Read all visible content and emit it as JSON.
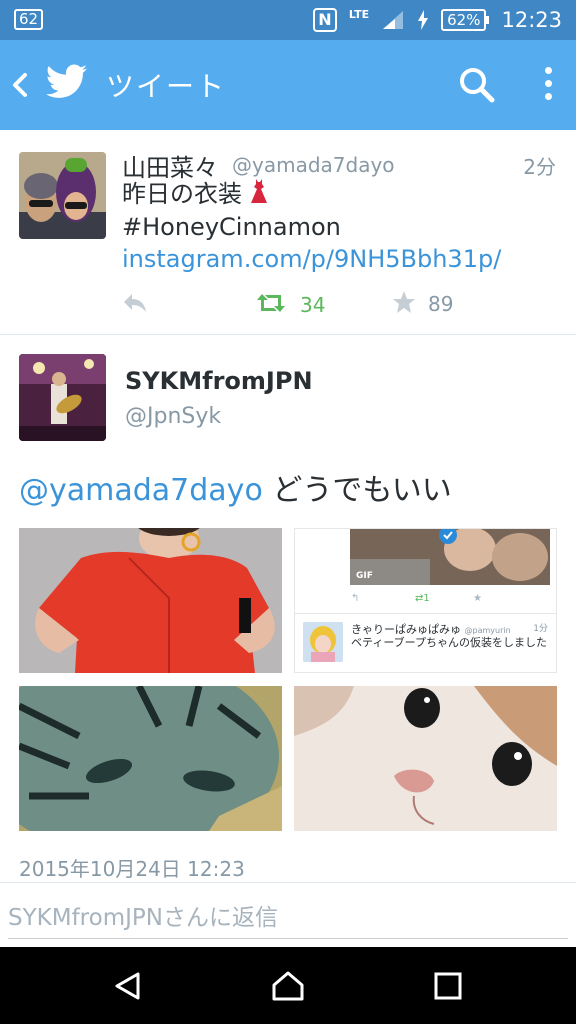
{
  "status_bar": {
    "notification_count": "62",
    "network": "LTE",
    "battery": "62%",
    "time": "12:23",
    "icons": [
      "nfc-icon",
      "signal-icon",
      "charging-icon",
      "battery-icon"
    ]
  },
  "app_bar": {
    "title": "ツイート",
    "icons": [
      "back-icon",
      "twitter-bird-icon",
      "search-icon",
      "overflow-menu-icon"
    ],
    "background": "#55acee",
    "status_background": "#3f88c5"
  },
  "tweet1": {
    "name": "山田菜々",
    "handle": "@yamada7dayo",
    "time": "2分",
    "text_line1": "昨日の衣装",
    "emoji_icon": "dress-icon",
    "hashtag": "#HoneyCinnamon",
    "link": "instagram.com/p/9NH5Bbh31p/",
    "retweets": "34",
    "favorites": "89"
  },
  "tweet2": {
    "name": "SYKMfromJPN",
    "handle": "@JpnSyk",
    "mention": "@yamada7dayo",
    "text": "どうでもいい",
    "date": "2015年10月24日 12:23",
    "embedded_tweet": {
      "gif_label": "GIF",
      "retweets": "1",
      "name": "きゃりーぱみゅぱみゅ",
      "handle": "@pamyurin",
      "time": "1分",
      "text": "ベティーブープちゃんの仮装をしました"
    }
  },
  "reply": {
    "placeholder": "SYKMfromJPNさんに返信"
  },
  "nav_bar": {
    "icons": [
      "back-nav-icon",
      "home-nav-icon",
      "recents-nav-icon"
    ]
  },
  "colors": {
    "link": "#3b94d9",
    "retweet_green": "#5cb85c",
    "muted": "#8899a6"
  }
}
